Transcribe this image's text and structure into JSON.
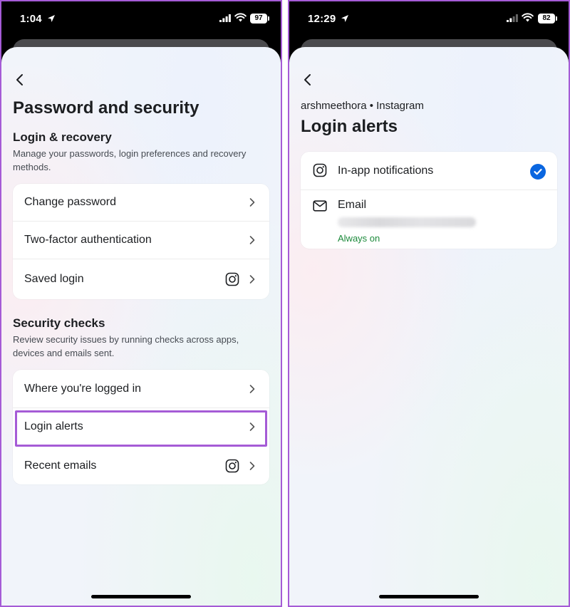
{
  "left": {
    "status": {
      "time": "1:04",
      "battery": "97"
    },
    "page_title": "Password and security",
    "login_recovery": {
      "heading": "Login & recovery",
      "description": "Manage your passwords, login preferences and recovery methods.",
      "items": [
        {
          "label": "Change password"
        },
        {
          "label": "Two-factor authentication"
        },
        {
          "label": "Saved login",
          "icon": "instagram-icon"
        }
      ]
    },
    "security_checks": {
      "heading": "Security checks",
      "description": "Review security issues by running checks across apps, devices and emails sent.",
      "items": [
        {
          "label": "Where you're logged in"
        },
        {
          "label": "Login alerts",
          "highlighted": true
        },
        {
          "label": "Recent emails",
          "icon": "instagram-icon"
        }
      ]
    }
  },
  "right": {
    "status": {
      "time": "12:29",
      "battery": "82"
    },
    "account": "arshmeethora • Instagram",
    "page_title": "Login alerts",
    "options": [
      {
        "label": "In-app notifications",
        "icon": "instagram-icon",
        "checked": true
      },
      {
        "label": "Email",
        "icon": "mail-icon",
        "note": "Always on"
      }
    ]
  },
  "colors": {
    "highlight": "#a55bd6",
    "accent": "#0a66e0",
    "success": "#1c8a3b"
  }
}
